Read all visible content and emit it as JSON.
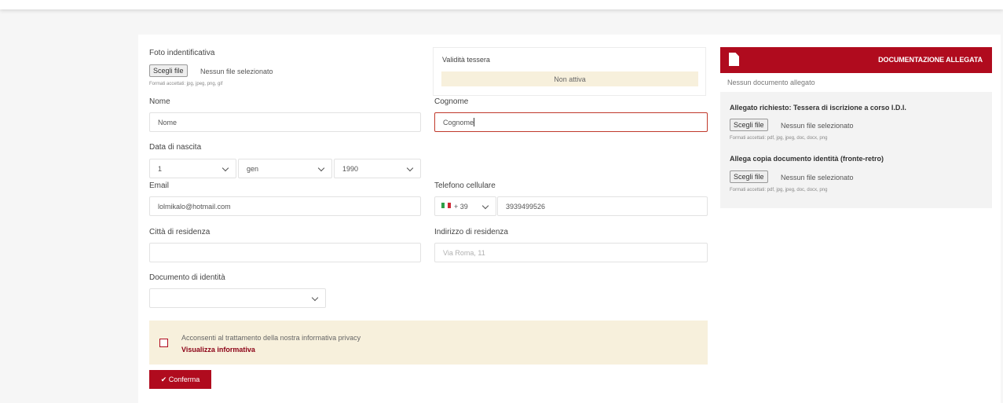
{
  "form": {
    "foto": {
      "label": "Foto indentificativa",
      "button": "Scegli file",
      "status": "Nessun file selezionato",
      "hint": "Formati accettati: jpg, jpeg, png, gif"
    },
    "validita": {
      "label": "Validità tessera",
      "status": "Non attiva"
    },
    "nome": {
      "label": "Nome",
      "value": "Nome"
    },
    "cognome": {
      "label": "Cognome",
      "value": "Cognome"
    },
    "nascita": {
      "label": "Data di nascita",
      "day": "1",
      "month": "gen",
      "year": "1990"
    },
    "email": {
      "label": "Email",
      "value": "lolmikalo@hotmail.com"
    },
    "telefono": {
      "label": "Telefono cellulare",
      "prefix": "+ 39",
      "value": "3939499526"
    },
    "citta": {
      "label": "Città di residenza",
      "value": ""
    },
    "indirizzo": {
      "label": "Indirizzo di residenza",
      "placeholder": "Via Roma, 11"
    },
    "documento": {
      "label": "Documento di identità",
      "value": ""
    },
    "privacy": {
      "text": "Acconsenti al trattamento della nostra informativa privacy",
      "link": "Visualizza informativa"
    },
    "confirm_label": "✔ Conferma"
  },
  "docs": {
    "title": "DOCUMENTAZIONE ALLEGATA",
    "icon": "document-icon",
    "none": "Nessun documento allegato",
    "required": {
      "label": "Allegato richiesto: Tessera di iscrizione a corso I.D.I.",
      "button": "Scegli file",
      "status": "Nessun file selezionato",
      "hint": "Formati accettati: pdf, jpg, jpeg, doc, docx, png"
    },
    "identity": {
      "label": "Allega copia documento identità (fronte-retro)",
      "button": "Scegli file",
      "status": "Nessun file selezionato",
      "hint": "Formati accettati: pdf, jpg, jpeg, doc, docx, png"
    }
  },
  "colors": {
    "accent": "#b00b1e",
    "highlight": "#f7f0dc"
  }
}
